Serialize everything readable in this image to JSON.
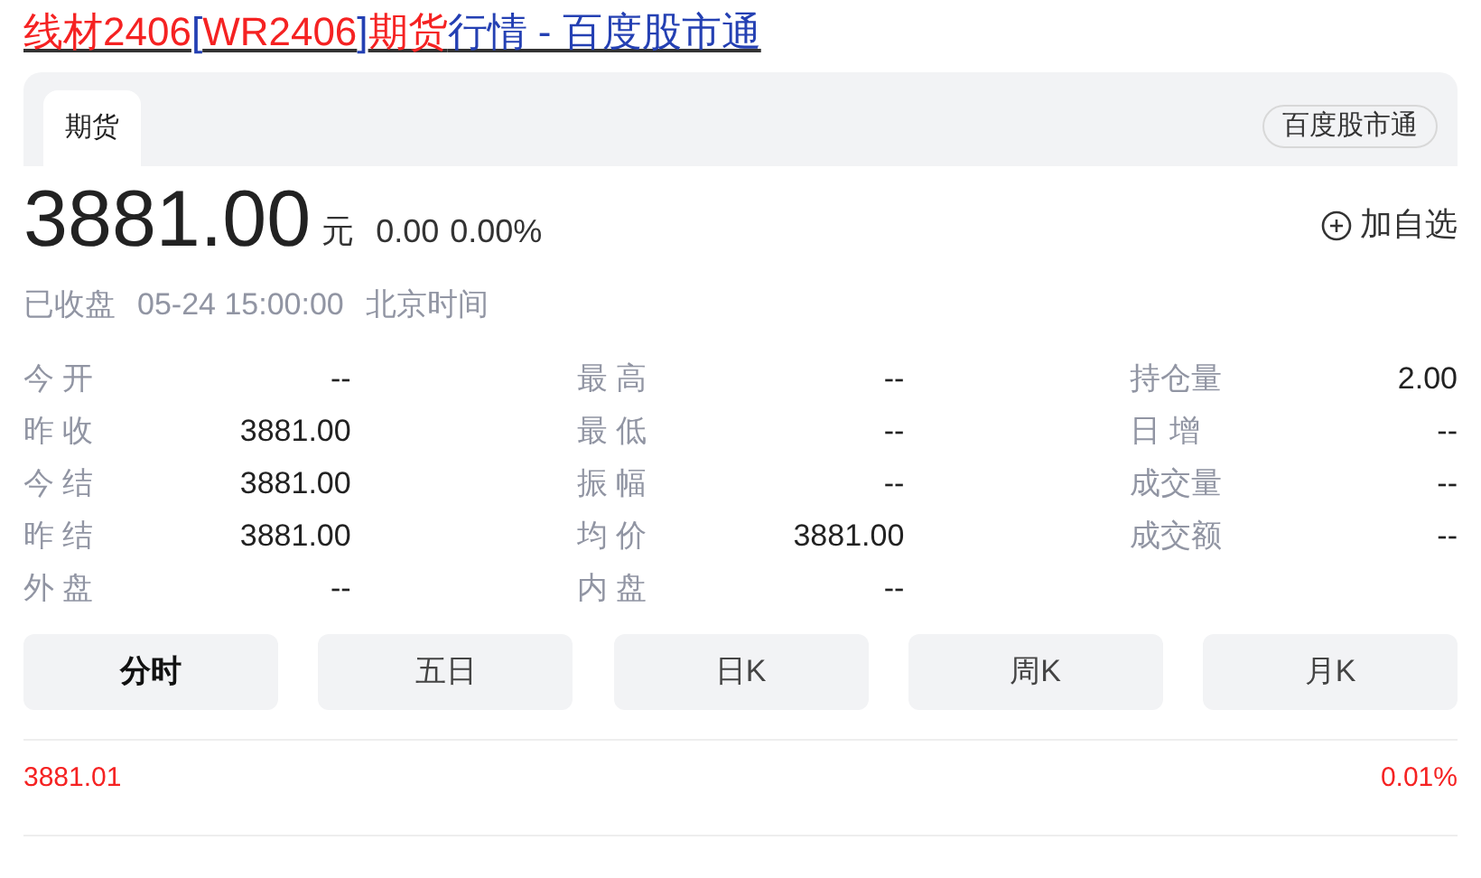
{
  "title": {
    "segments": [
      {
        "text": "线材2406",
        "kind": "highlight"
      },
      {
        "text": "[",
        "kind": "plain"
      },
      {
        "text": "WR2406",
        "kind": "highlight"
      },
      {
        "text": "]",
        "kind": "plain"
      },
      {
        "text": "期货",
        "kind": "highlight"
      },
      {
        "text": "行情 - 百度股市通",
        "kind": "plain"
      }
    ]
  },
  "tabs": [
    {
      "label": "期货",
      "selected": true
    }
  ],
  "source_badge": "百度股市通",
  "quote": {
    "price": "3881.00",
    "unit": "元",
    "change": "0.00",
    "change_pct": "0.00%",
    "add_watchlist": "加自选"
  },
  "status": {
    "state": "已收盘",
    "time": "05-24 15:00:00",
    "timezone": "北京时间"
  },
  "stats": [
    [
      {
        "label": "今 开",
        "value": "--"
      },
      {
        "label": "昨 收",
        "value": "3881.00"
      },
      {
        "label": "今 结",
        "value": "3881.00"
      },
      {
        "label": "昨 结",
        "value": "3881.00"
      },
      {
        "label": "外 盘",
        "value": "--"
      }
    ],
    [
      {
        "label": "最 高",
        "value": "--"
      },
      {
        "label": "最 低",
        "value": "--"
      },
      {
        "label": "振 幅",
        "value": "--"
      },
      {
        "label": "均 价",
        "value": "3881.00"
      },
      {
        "label": "内 盘",
        "value": "--"
      }
    ],
    [
      {
        "label": "持仓量",
        "value": "2.00"
      },
      {
        "label": "日 增",
        "value": "--"
      },
      {
        "label": "成交量",
        "value": "--"
      },
      {
        "label": "成交额",
        "value": "--"
      }
    ]
  ],
  "chart_tabs": [
    {
      "label": "分时",
      "selected": true
    },
    {
      "label": "五日",
      "selected": false
    },
    {
      "label": "日K",
      "selected": false
    },
    {
      "label": "周K",
      "selected": false
    },
    {
      "label": "月K",
      "selected": false
    }
  ],
  "chart_header": {
    "price": "3881.01",
    "pct": "0.01%"
  }
}
